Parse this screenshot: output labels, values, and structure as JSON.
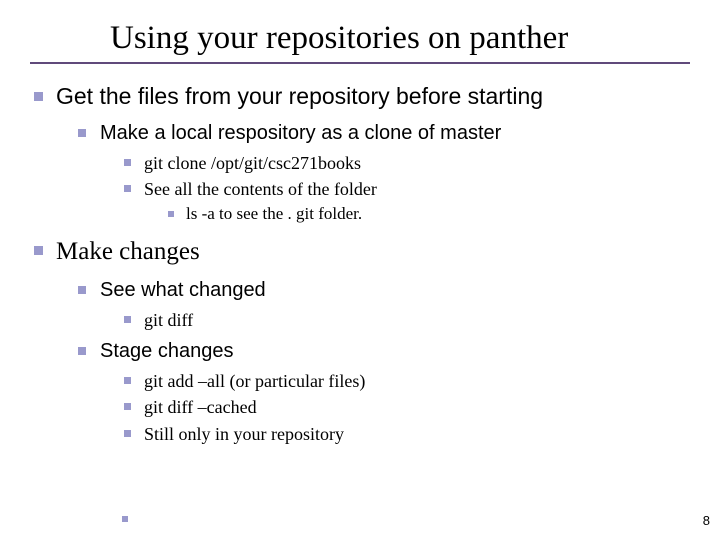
{
  "title": "Using your repositories on panther",
  "items": [
    {
      "text": "Get the files from your repository before starting",
      "style": "sans",
      "children": [
        {
          "text": "Make a local respository as a clone of master",
          "children": [
            {
              "text": "git clone /opt/git/csc271books"
            },
            {
              "text": "See all the contents of the folder",
              "children": [
                {
                  "text": "ls  -a to see the . git folder."
                }
              ]
            }
          ]
        }
      ]
    },
    {
      "text": "Make changes",
      "style": "serif",
      "children": [
        {
          "text": "See what changed",
          "children": [
            {
              "text": "git diff"
            }
          ]
        },
        {
          "text": "Stage changes",
          "children": [
            {
              "text": "git add –all (or particular files)"
            },
            {
              "text": "git  diff –cached"
            },
            {
              "text": "Still only in your repository"
            }
          ]
        }
      ]
    }
  ],
  "page_number": "8"
}
